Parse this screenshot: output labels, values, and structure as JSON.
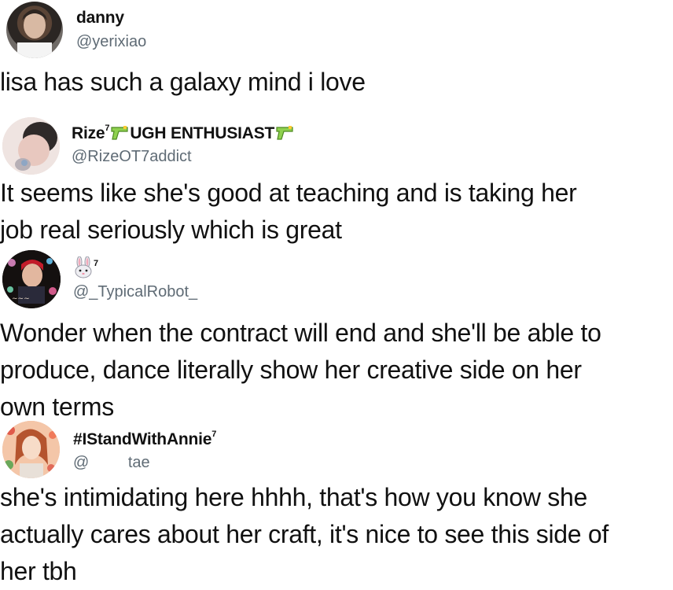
{
  "tweets": [
    {
      "display_name": "danny",
      "handle": "@yerixiao",
      "lines": [
        "lisa has such a galaxy mind i love"
      ]
    },
    {
      "display_name_a": "Rize",
      "display_name_sup": "7",
      "display_name_b": "UGH ENTHUSIAST",
      "handle": "@RizeOT7addict",
      "lines": [
        "It seems like she's good at teaching and is taking her",
        "job real seriously which is great"
      ]
    },
    {
      "display_name_sup": "7",
      "handle": "@_TypicalRobot_",
      "lines": [
        "Wonder when the contract will end and she'll be able to",
        "produce, dance literally show her creative side on her",
        "own terms"
      ]
    },
    {
      "display_name": "#IStandWithAnnie",
      "display_name_sup": "7",
      "handle_at": "@",
      "handle_rest": "tae",
      "lines": [
        "she's intimidating here hhhh, that's how you know she",
        "actually cares about her craft, it's nice to see this side of",
        "her tbh"
      ]
    }
  ],
  "icons": {
    "emoji_water_gun": "water-pistol-icon",
    "emoji_rabbit": "rabbit-face-icon"
  },
  "colors": {
    "text": "#111111",
    "handle": "#5f6b75",
    "background": "#ffffff"
  }
}
